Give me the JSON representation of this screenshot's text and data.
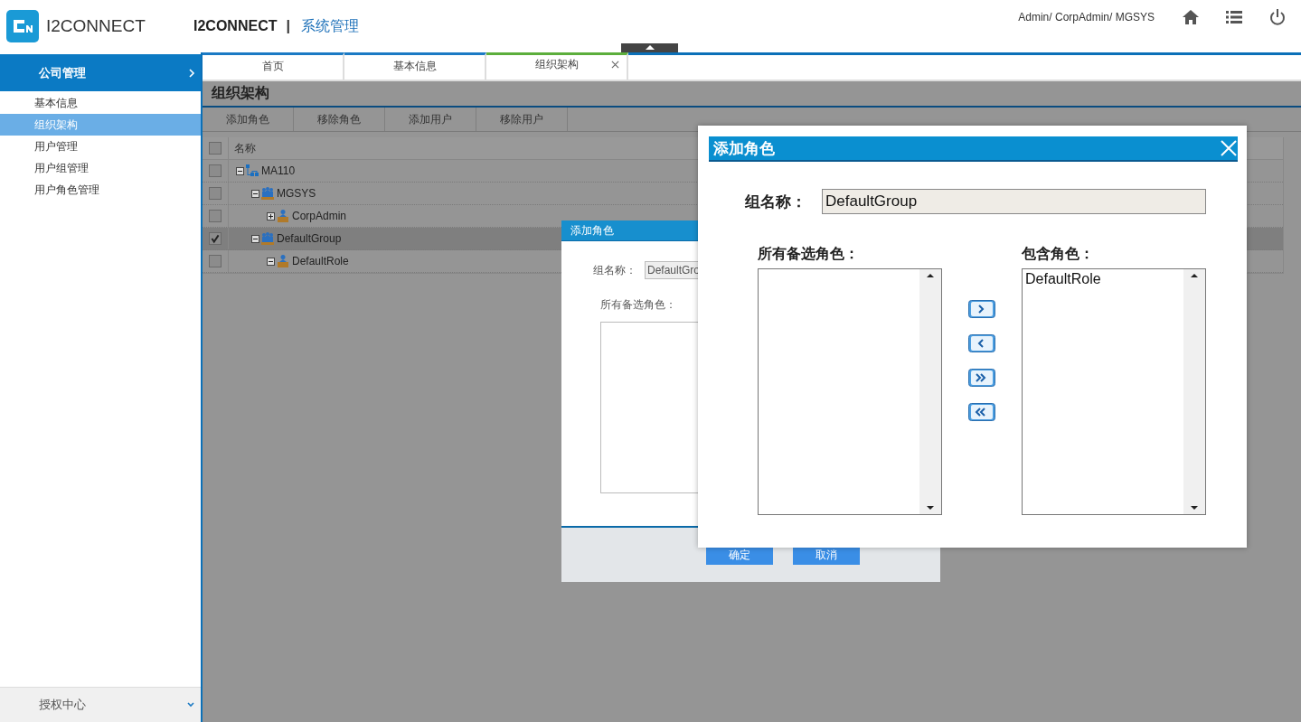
{
  "header": {
    "logo_text": "I2CONNECT",
    "app_name": "I2CONNECT",
    "separator": "|",
    "module": "系统管理",
    "user_path": "Admin/ CorpAdmin/ MGSYS"
  },
  "sidebar": {
    "section": "公司管理",
    "items": [
      {
        "label": "基本信息",
        "selected": false
      },
      {
        "label": "组织架构",
        "selected": true
      },
      {
        "label": "用户管理",
        "selected": false
      },
      {
        "label": "用户组管理",
        "selected": false
      },
      {
        "label": "用户角色管理",
        "selected": false
      }
    ],
    "footer": "授权中心"
  },
  "tabs": [
    {
      "label": "首页",
      "selected": false,
      "closable": false
    },
    {
      "label": "基本信息",
      "selected": false,
      "closable": false
    },
    {
      "label": "组织架构",
      "selected": true,
      "closable": true
    }
  ],
  "page": {
    "title": "组织架构",
    "toolbar": [
      "添加角色",
      "移除角色",
      "添加用户",
      "移除用户"
    ],
    "table": {
      "column": "名称",
      "all_checked": false,
      "rows": [
        {
          "label": "MA110",
          "kind": "org",
          "checked": false,
          "expanded": true,
          "children": [
            {
              "label": "MGSYS",
              "kind": "group",
              "checked": false,
              "expanded": true,
              "children": [
                {
                  "label": "CorpAdmin",
                  "kind": "role",
                  "checked": false,
                  "expanded": false
                }
              ]
            },
            {
              "label": "DefaultGroup",
              "kind": "group",
              "checked": true,
              "expanded": true,
              "children": [
                {
                  "label": "DefaultRole",
                  "kind": "role",
                  "checked": false,
                  "expanded": true
                }
              ]
            }
          ]
        }
      ]
    }
  },
  "dialog_back": {
    "title": "添加角色",
    "group_label": "组名称：",
    "group_value": "DefaultGro",
    "roles_label": "所有备选角色：",
    "buttons": [
      "确定",
      "取消"
    ]
  },
  "dialog_front": {
    "title": "添加角色",
    "group_label": "组名称：",
    "group_value": "DefaultGroup",
    "available_label": "所有备选角色：",
    "included_label": "包含角色：",
    "included": [
      "DefaultRole"
    ],
    "transfer": [
      {
        "kind": "add"
      },
      {
        "kind": "remove"
      },
      {
        "kind": "add_all"
      },
      {
        "kind": "remove_all"
      }
    ]
  }
}
